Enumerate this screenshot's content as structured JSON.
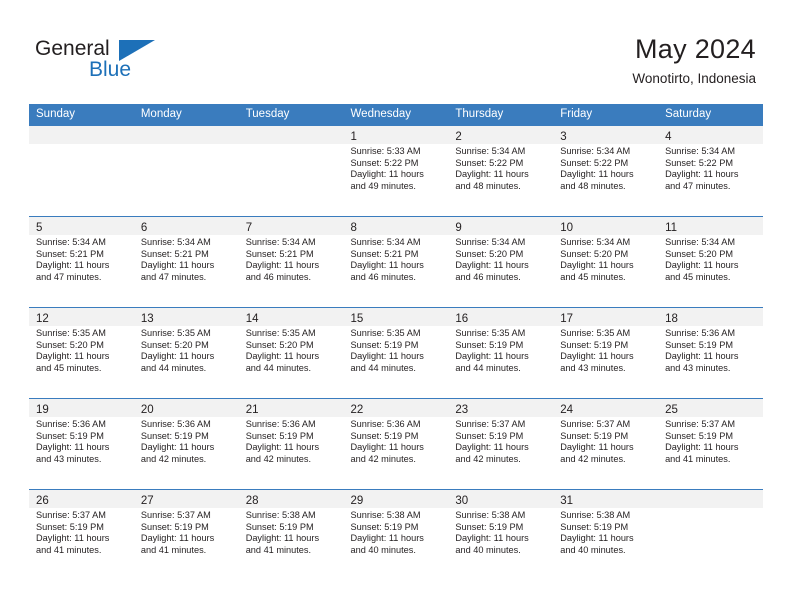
{
  "logo": {
    "word_top": "General",
    "word_bottom": "Blue",
    "triangle_icon": "blue-triangle-icon",
    "brand_color": "#1d70b8"
  },
  "header": {
    "title": "May 2024",
    "subtitle": "Wonotirto, Indonesia"
  },
  "colors": {
    "header_blue": "#3a7cbe",
    "daynum_band": "#f2f2f2",
    "text": "#231f20"
  },
  "calendar": {
    "day_headers": [
      "Sunday",
      "Monday",
      "Tuesday",
      "Wednesday",
      "Thursday",
      "Friday",
      "Saturday"
    ],
    "labels": {
      "sunrise": "Sunrise:",
      "sunset": "Sunset:",
      "daylight": "Daylight:"
    },
    "weeks": [
      [
        {
          "day": "",
          "lines": []
        },
        {
          "day": "",
          "lines": []
        },
        {
          "day": "",
          "lines": []
        },
        {
          "day": "1",
          "lines": [
            "Sunrise: 5:33 AM",
            "Sunset: 5:22 PM",
            "Daylight: 11 hours",
            "and 49 minutes."
          ]
        },
        {
          "day": "2",
          "lines": [
            "Sunrise: 5:34 AM",
            "Sunset: 5:22 PM",
            "Daylight: 11 hours",
            "and 48 minutes."
          ]
        },
        {
          "day": "3",
          "lines": [
            "Sunrise: 5:34 AM",
            "Sunset: 5:22 PM",
            "Daylight: 11 hours",
            "and 48 minutes."
          ]
        },
        {
          "day": "4",
          "lines": [
            "Sunrise: 5:34 AM",
            "Sunset: 5:22 PM",
            "Daylight: 11 hours",
            "and 47 minutes."
          ]
        }
      ],
      [
        {
          "day": "5",
          "lines": [
            "Sunrise: 5:34 AM",
            "Sunset: 5:21 PM",
            "Daylight: 11 hours",
            "and 47 minutes."
          ]
        },
        {
          "day": "6",
          "lines": [
            "Sunrise: 5:34 AM",
            "Sunset: 5:21 PM",
            "Daylight: 11 hours",
            "and 47 minutes."
          ]
        },
        {
          "day": "7",
          "lines": [
            "Sunrise: 5:34 AM",
            "Sunset: 5:21 PM",
            "Daylight: 11 hours",
            "and 46 minutes."
          ]
        },
        {
          "day": "8",
          "lines": [
            "Sunrise: 5:34 AM",
            "Sunset: 5:21 PM",
            "Daylight: 11 hours",
            "and 46 minutes."
          ]
        },
        {
          "day": "9",
          "lines": [
            "Sunrise: 5:34 AM",
            "Sunset: 5:20 PM",
            "Daylight: 11 hours",
            "and 46 minutes."
          ]
        },
        {
          "day": "10",
          "lines": [
            "Sunrise: 5:34 AM",
            "Sunset: 5:20 PM",
            "Daylight: 11 hours",
            "and 45 minutes."
          ]
        },
        {
          "day": "11",
          "lines": [
            "Sunrise: 5:34 AM",
            "Sunset: 5:20 PM",
            "Daylight: 11 hours",
            "and 45 minutes."
          ]
        }
      ],
      [
        {
          "day": "12",
          "lines": [
            "Sunrise: 5:35 AM",
            "Sunset: 5:20 PM",
            "Daylight: 11 hours",
            "and 45 minutes."
          ]
        },
        {
          "day": "13",
          "lines": [
            "Sunrise: 5:35 AM",
            "Sunset: 5:20 PM",
            "Daylight: 11 hours",
            "and 44 minutes."
          ]
        },
        {
          "day": "14",
          "lines": [
            "Sunrise: 5:35 AM",
            "Sunset: 5:20 PM",
            "Daylight: 11 hours",
            "and 44 minutes."
          ]
        },
        {
          "day": "15",
          "lines": [
            "Sunrise: 5:35 AM",
            "Sunset: 5:19 PM",
            "Daylight: 11 hours",
            "and 44 minutes."
          ]
        },
        {
          "day": "16",
          "lines": [
            "Sunrise: 5:35 AM",
            "Sunset: 5:19 PM",
            "Daylight: 11 hours",
            "and 44 minutes."
          ]
        },
        {
          "day": "17",
          "lines": [
            "Sunrise: 5:35 AM",
            "Sunset: 5:19 PM",
            "Daylight: 11 hours",
            "and 43 minutes."
          ]
        },
        {
          "day": "18",
          "lines": [
            "Sunrise: 5:36 AM",
            "Sunset: 5:19 PM",
            "Daylight: 11 hours",
            "and 43 minutes."
          ]
        }
      ],
      [
        {
          "day": "19",
          "lines": [
            "Sunrise: 5:36 AM",
            "Sunset: 5:19 PM",
            "Daylight: 11 hours",
            "and 43 minutes."
          ]
        },
        {
          "day": "20",
          "lines": [
            "Sunrise: 5:36 AM",
            "Sunset: 5:19 PM",
            "Daylight: 11 hours",
            "and 42 minutes."
          ]
        },
        {
          "day": "21",
          "lines": [
            "Sunrise: 5:36 AM",
            "Sunset: 5:19 PM",
            "Daylight: 11 hours",
            "and 42 minutes."
          ]
        },
        {
          "day": "22",
          "lines": [
            "Sunrise: 5:36 AM",
            "Sunset: 5:19 PM",
            "Daylight: 11 hours",
            "and 42 minutes."
          ]
        },
        {
          "day": "23",
          "lines": [
            "Sunrise: 5:37 AM",
            "Sunset: 5:19 PM",
            "Daylight: 11 hours",
            "and 42 minutes."
          ]
        },
        {
          "day": "24",
          "lines": [
            "Sunrise: 5:37 AM",
            "Sunset: 5:19 PM",
            "Daylight: 11 hours",
            "and 42 minutes."
          ]
        },
        {
          "day": "25",
          "lines": [
            "Sunrise: 5:37 AM",
            "Sunset: 5:19 PM",
            "Daylight: 11 hours",
            "and 41 minutes."
          ]
        }
      ],
      [
        {
          "day": "26",
          "lines": [
            "Sunrise: 5:37 AM",
            "Sunset: 5:19 PM",
            "Daylight: 11 hours",
            "and 41 minutes."
          ]
        },
        {
          "day": "27",
          "lines": [
            "Sunrise: 5:37 AM",
            "Sunset: 5:19 PM",
            "Daylight: 11 hours",
            "and 41 minutes."
          ]
        },
        {
          "day": "28",
          "lines": [
            "Sunrise: 5:38 AM",
            "Sunset: 5:19 PM",
            "Daylight: 11 hours",
            "and 41 minutes."
          ]
        },
        {
          "day": "29",
          "lines": [
            "Sunrise: 5:38 AM",
            "Sunset: 5:19 PM",
            "Daylight: 11 hours",
            "and 40 minutes."
          ]
        },
        {
          "day": "30",
          "lines": [
            "Sunrise: 5:38 AM",
            "Sunset: 5:19 PM",
            "Daylight: 11 hours",
            "and 40 minutes."
          ]
        },
        {
          "day": "31",
          "lines": [
            "Sunrise: 5:38 AM",
            "Sunset: 5:19 PM",
            "Daylight: 11 hours",
            "and 40 minutes."
          ]
        },
        {
          "day": "",
          "lines": []
        }
      ]
    ]
  }
}
